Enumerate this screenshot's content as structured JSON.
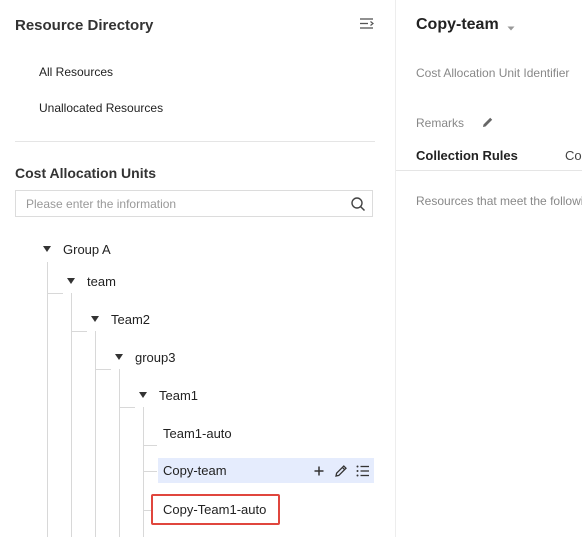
{
  "sidebar": {
    "title": "Resource Directory",
    "links": [
      "All Resources",
      "Unallocated Resources"
    ],
    "cost_units_title": "Cost Allocation Units",
    "search": {
      "placeholder": "Please enter the information",
      "value": ""
    },
    "tree": [
      {
        "label": "Group A",
        "level": 0,
        "expanded": true
      },
      {
        "label": "team",
        "level": 1,
        "expanded": true
      },
      {
        "label": "Team2",
        "level": 2,
        "expanded": true
      },
      {
        "label": "group3",
        "level": 3,
        "expanded": true
      },
      {
        "label": "Team1",
        "level": 4,
        "expanded": true
      },
      {
        "label": "Team1-auto",
        "level": 5
      },
      {
        "label": "Copy-team",
        "level": 5,
        "selected": true
      },
      {
        "label": "Copy-Team1-auto",
        "level": 5,
        "highlighted": true
      }
    ],
    "row_action_icons": [
      "plus-icon",
      "pencil-icon",
      "list-icon"
    ],
    "collapse_icon": "collapse-menu-icon"
  },
  "detail": {
    "title": "Copy-team",
    "identifier_label": "Cost Allocation Unit Identifier",
    "remarks_label": "Remarks",
    "tabs": [
      "Collection Rules",
      "Co"
    ],
    "active_tab": 0,
    "rule_text": "Resources that meet the followi"
  },
  "colors": {
    "accent": "#1664ff",
    "selected_bg": "#e5ecfd",
    "highlight_border": "#e0463d"
  }
}
